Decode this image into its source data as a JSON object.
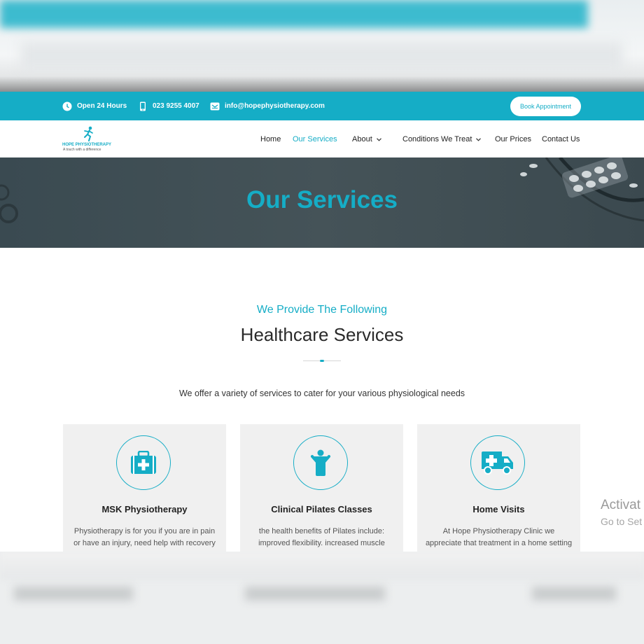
{
  "topbar": {
    "hours": "Open 24 Hours",
    "phone": "023 9255 4007",
    "email": "info@hopephysiotherapy.com",
    "book_label": "Book Appointment"
  },
  "logo": {
    "brand": "HOPE PHYSIOTHERAPY",
    "tagline": "A touch with a difference"
  },
  "nav": {
    "items": [
      {
        "label": "Home"
      },
      {
        "label": "Our Services"
      },
      {
        "label": "About"
      },
      {
        "label": "Conditions We Treat"
      },
      {
        "label": "Our Prices"
      },
      {
        "label": "Contact Us"
      }
    ]
  },
  "hero": {
    "title": "Our Services"
  },
  "section": {
    "subtitle": "We Provide The Following",
    "title": "Healthcare Services",
    "intro": "We offer a variety of services to cater for your various physiological needs"
  },
  "cards": [
    {
      "title": "MSK Physiotherapy",
      "text": "Physiotherapy is for you if you are in pain or have an injury, need help with recovery using",
      "icon": "medical-kit-icon"
    },
    {
      "title": "Clinical Pilates Classes",
      "text": "the health benefits of Pilates include: improved flexibility. increased muscle",
      "icon": "person-icon"
    },
    {
      "title": "Home Visits",
      "text": "At Hope Physiotherapy Clinic we appreciate that treatment in a home setting is",
      "icon": "ambulance-icon"
    }
  ],
  "watermark": {
    "line1": "Activat",
    "line2": "Go to Set"
  },
  "colors": {
    "accent": "#15adc6",
    "hero_bg": "#414f55",
    "card_bg": "#f0f0f0"
  }
}
